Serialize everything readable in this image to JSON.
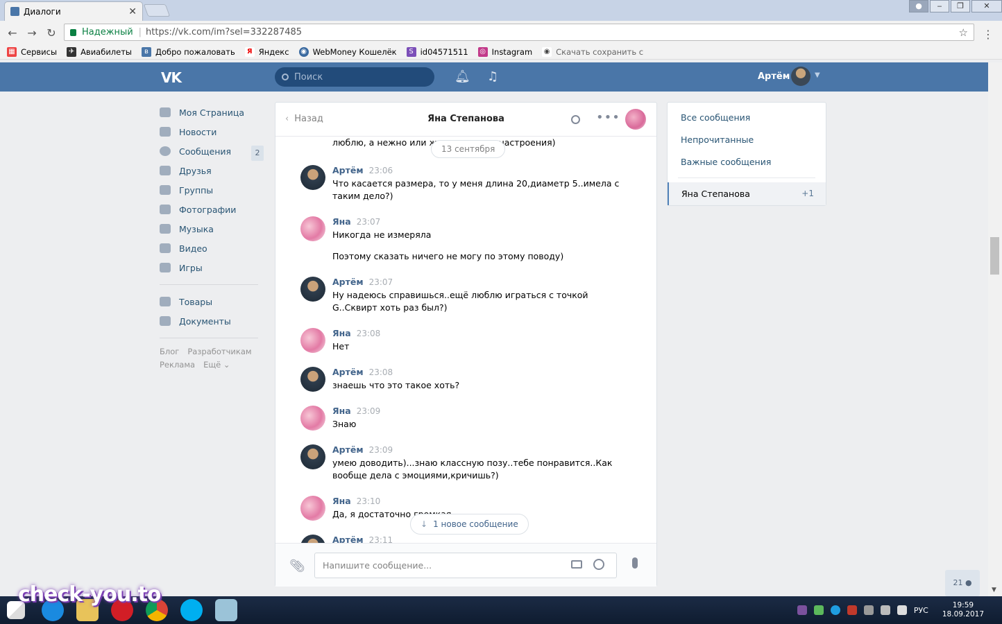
{
  "browser": {
    "tab_title": "Диалоги",
    "secure_label": "Надежный",
    "url": "https://vk.com/im?sel=332287485",
    "bookmarks": [
      "Сервисы",
      "Авиабилеты",
      "Добро пожаловать",
      "Яндекс",
      "WebMoney Кошелёк",
      "id04571511",
      "Instagram",
      "Скачать сохранить с"
    ]
  },
  "header": {
    "logo": "VK",
    "search_placeholder": "Поиск",
    "user_name": "Артём"
  },
  "leftnav": {
    "items": [
      {
        "label": "Моя Страница"
      },
      {
        "label": "Новости"
      },
      {
        "label": "Сообщения",
        "badge": "2"
      },
      {
        "label": "Друзья"
      },
      {
        "label": "Группы"
      },
      {
        "label": "Фотографии"
      },
      {
        "label": "Музыка"
      },
      {
        "label": "Видео"
      },
      {
        "label": "Игры"
      }
    ],
    "items2": [
      {
        "label": "Товары"
      },
      {
        "label": "Документы"
      }
    ],
    "footer": [
      "Блог",
      "Разработчикам",
      "Реклама",
      "Ещё ⌄"
    ]
  },
  "chat": {
    "back_label": "Назад",
    "peer_name": "Яна Степанова",
    "cut_line": "люблю, а нежно или же                           симости от настроения)",
    "date_pill": "13 сентября",
    "messages": [
      {
        "name": "Артём",
        "time": "23:06",
        "text": "Что касается размера, то у меня длина 20,диаметр 5..имела с таким дело?)"
      },
      {
        "name": "Яна",
        "time": "23:07",
        "text": "Никогда не измеряла",
        "text2": "Поэтому сказать ничего не могу по этому поводу)"
      },
      {
        "name": "Артём",
        "time": "23:07",
        "text": "Ну надеюсь справишься..ещё люблю играться с точкой G..Сквирт хоть раз был?)"
      },
      {
        "name": "Яна",
        "time": "23:08",
        "text": "Нет"
      },
      {
        "name": "Артём",
        "time": "23:08",
        "text": "знаешь что это такое хоть?"
      },
      {
        "name": "Яна",
        "time": "23:09",
        "text": "Знаю"
      },
      {
        "name": "Артём",
        "time": "23:09",
        "text": "умею доводить)...знаю классную позу..тебе понравится..Как вообще дела с эмоциями,кричишь?)"
      },
      {
        "name": "Яна",
        "time": "23:10",
        "text": "Да, я достаточно громкая"
      },
      {
        "name": "Артём",
        "time": "23:11",
        "text": ""
      }
    ],
    "new_message_label": "1 новое сообщение",
    "input_placeholder": "Напишите сообщение..."
  },
  "rightpanel": {
    "filters": [
      "Все сообщения",
      "Непрочитанные",
      "Важные сообщения"
    ],
    "selected": {
      "name": "Яна Степанова",
      "count": "+1"
    }
  },
  "bottom_counter": "21 ●",
  "taskbar": {
    "lang": "РУС",
    "time": "19:59",
    "date": "18.09.2017"
  },
  "watermark": "check-you.to"
}
